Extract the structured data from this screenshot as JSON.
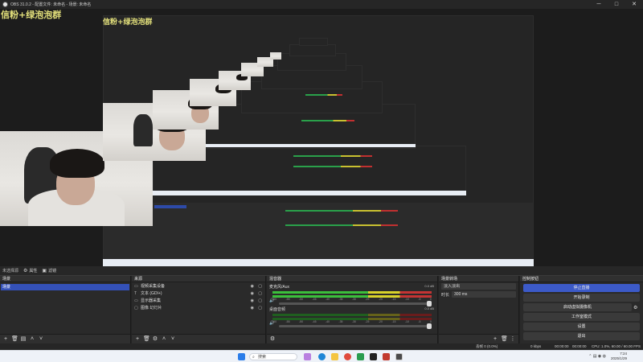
{
  "window": {
    "title": "OBS 31.0.2 - 配置文件: 未命名 - 场景: 未命名",
    "controls": [
      "─",
      "□",
      "✕"
    ]
  },
  "preview": {
    "overlay_line1": "信粉+绿泡泡群",
    "overlay_line2": "信粉+绿泡泡群"
  },
  "substrip": {
    "label": "未选择源",
    "properties": "属性",
    "filters": "滤镜"
  },
  "scenes": {
    "title": "场景",
    "items": [
      {
        "label": "场景"
      }
    ]
  },
  "sources": {
    "title": "来源",
    "items": [
      {
        "label": "视频采集设备",
        "icon": "camera-icon"
      },
      {
        "label": "文本 (GDI+)",
        "icon": "text-icon"
      },
      {
        "label": "显示器采集",
        "icon": "monitor-icon"
      },
      {
        "label": "图像 幻灯片",
        "icon": "image-icon"
      }
    ]
  },
  "mixer": {
    "title": "混音器",
    "channels": [
      {
        "name": "麦克风/Aux",
        "db": "0.0 dB",
        "level": 0.75
      },
      {
        "name": "桌面音频",
        "db": "0.0 dB",
        "level": 0.0
      }
    ],
    "ticks": [
      "-60",
      "-55",
      "-50",
      "-45",
      "-40",
      "-35",
      "-30",
      "-25",
      "-20",
      "-15",
      "-10",
      "-5",
      "0"
    ]
  },
  "transitions": {
    "title": "场景转场",
    "selected": "淡入淡出",
    "duration_label": "时长",
    "duration_value": "300 ms"
  },
  "controls": {
    "title": "控制按钮",
    "buttons": [
      {
        "label": "停止直播",
        "primary": true
      },
      {
        "label": "开始录制",
        "primary": false
      },
      {
        "label": "启动虚拟摄像机",
        "primary": false
      },
      {
        "label": "工作室模式",
        "primary": false
      },
      {
        "label": "设置",
        "primary": false
      },
      {
        "label": "退出",
        "primary": false
      }
    ]
  },
  "status": {
    "dropped": "丢帧 0 (0.0%)",
    "rate": "0 kbps",
    "live_time": "00:00:00",
    "rec_time": "00:00:00",
    "cpu": "CPU: 1.0%, 60.00 / 60.00 FPS"
  },
  "taskbar": {
    "search_placeholder": "搜索",
    "time": "7:24",
    "date": "2025/1/29"
  },
  "colors": {
    "accent": "#3c5ac8",
    "overlay_text": "#e3e07b",
    "panel": "#2a2a2a"
  }
}
